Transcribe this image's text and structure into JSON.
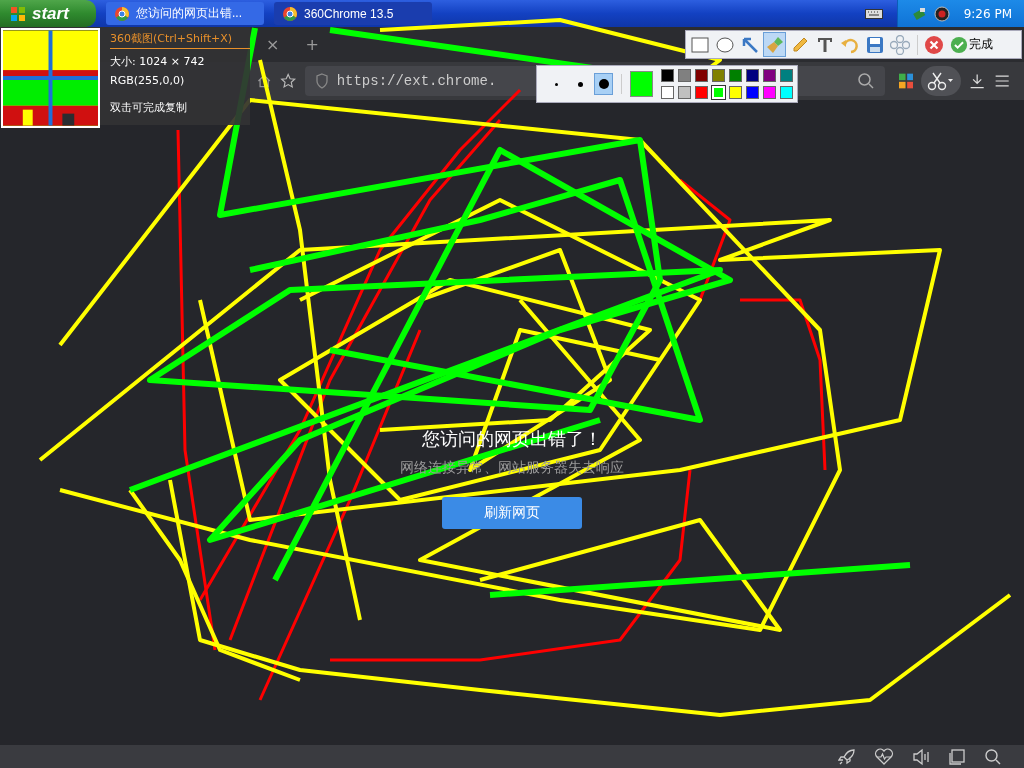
{
  "taskbar": {
    "start_label": "start",
    "tasks": [
      {
        "title": "您访问的网页出错...",
        "selected": true
      },
      {
        "title": "360Chrome 13.5",
        "selected": false
      }
    ],
    "clock": "9:26 PM"
  },
  "browser": {
    "tab_close": "×",
    "new_tab": "+",
    "address": "https://ext.chrome.",
    "error": {
      "heading": "您访问的网页出错了！",
      "message": "网络连接异常、网站服务器失去响应",
      "button": "刷新网页"
    }
  },
  "capture_info": {
    "title": "360截图(Ctrl+Shift+X)",
    "size": "大小: 1024 × 742",
    "rgb": "RGB(255,0,0)",
    "hint": "双击可完成复制"
  },
  "annotation_toolbar": {
    "tools": [
      {
        "kind": "rectangle",
        "selected": false
      },
      {
        "kind": "ellipse",
        "selected": false
      },
      {
        "kind": "arrow",
        "selected": false
      },
      {
        "kind": "brush",
        "selected": true
      },
      {
        "kind": "pencil",
        "selected": false
      },
      {
        "kind": "text",
        "selected": false
      },
      {
        "kind": "undo",
        "selected": false
      },
      {
        "kind": "save",
        "selected": false
      },
      {
        "kind": "mosaic",
        "selected": false
      }
    ],
    "done_label": "完成"
  },
  "palette": {
    "sizes": [
      {
        "selected": false
      },
      {
        "selected": false
      },
      {
        "selected": true
      }
    ],
    "swatches": [
      {
        "color": "#000000",
        "selected": false
      },
      {
        "color": "#808080",
        "selected": false
      },
      {
        "color": "#800000",
        "selected": false
      },
      {
        "color": "#808000",
        "selected": false
      },
      {
        "color": "#008000",
        "selected": false
      },
      {
        "color": "#000080",
        "selected": false
      },
      {
        "color": "#800080",
        "selected": false
      },
      {
        "color": "#008080",
        "selected": false
      },
      {
        "color": "#ffffff",
        "selected": false
      },
      {
        "color": "#c0c0c0",
        "selected": false
      },
      {
        "color": "#ff0000",
        "selected": false
      },
      {
        "color": "#00ff00",
        "selected": true
      },
      {
        "color": "#ffff00",
        "selected": false
      },
      {
        "color": "#0000ff",
        "selected": false
      },
      {
        "color": "#ff00ff",
        "selected": false
      },
      {
        "color": "#00ffff",
        "selected": false
      }
    ]
  }
}
